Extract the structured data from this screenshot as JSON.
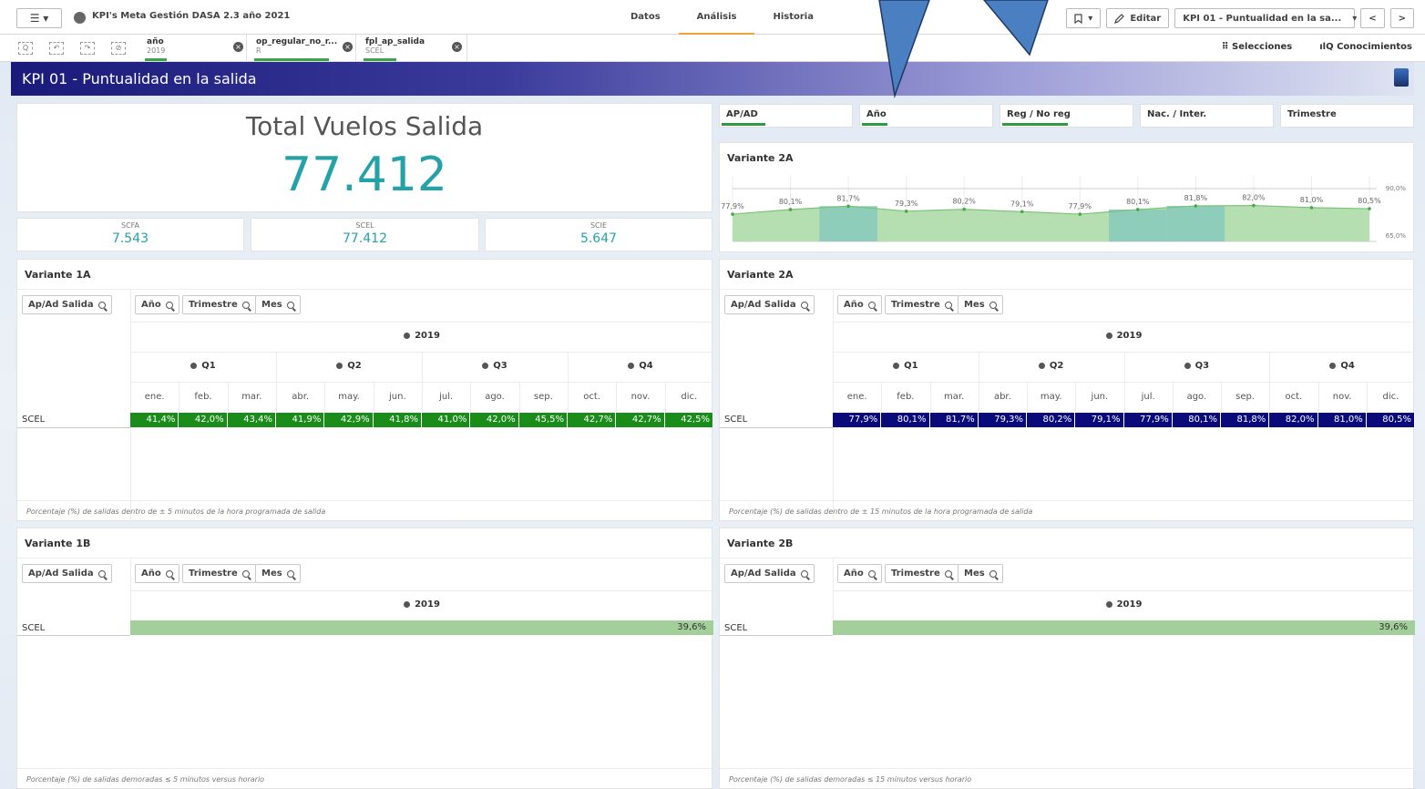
{
  "app": {
    "title": "KPI's Meta Gestión DASA 2.3 año 2021",
    "menu_label": "☰ ▾"
  },
  "nav_tabs": [
    {
      "label": "Datos"
    },
    {
      "label": "Análisis"
    },
    {
      "label": "Historia"
    }
  ],
  "toolbar": {
    "bookmark_label": "▾",
    "edit_label": "Editar",
    "sheet_selector": "KPI 01 - Puntualidad en la sa...",
    "prev": "<",
    "next": ">"
  },
  "selections": {
    "chips": [
      {
        "field": "año",
        "value": "2019"
      },
      {
        "field": "op_regular_no_r...",
        "value": "R"
      },
      {
        "field": "fpl_ap_salida",
        "value": "SCEL"
      }
    ],
    "selecciones_label": "Selecciones",
    "conocimientos_label": "Conocimientos"
  },
  "sheet": {
    "title": "KPI 01 - Puntualidad en la salida"
  },
  "kpi": {
    "title": "Total Vuelos Salida",
    "value": "77.412",
    "subs": [
      {
        "label": "SCFA",
        "value": "7.543"
      },
      {
        "label": "SCEL",
        "value": "77.412"
      },
      {
        "label": "SCIE",
        "value": "5.647"
      }
    ]
  },
  "filters": [
    {
      "label": "AP/AD"
    },
    {
      "label": "Año"
    },
    {
      "label": "Reg / No reg"
    },
    {
      "label": "Nac. / Inter."
    },
    {
      "label": "Trimestre"
    }
  ],
  "trend_chart": {
    "title": "Variante 2A",
    "ref_top": "90,0%",
    "ref_bottom": "65,0%"
  },
  "chart_data": {
    "type": "area",
    "categories": [
      "ene.",
      "feb.",
      "mar.",
      "abr.",
      "may.",
      "jun.",
      "jul.",
      "ago.",
      "sep.",
      "oct.",
      "nov.",
      "dic."
    ],
    "series": [
      {
        "values": [
          77.9,
          80.1,
          81.7,
          79.3,
          80.2,
          79.1,
          77.9,
          80.1,
          81.8,
          82.0,
          81.0,
          80.5
        ]
      }
    ],
    "labels": [
      "77,9%",
      "80,1%",
      "81,7%",
      "79,3%",
      "80,2%",
      "79,1%",
      "77,9%",
      "80,1%",
      "81,8%",
      "82,0%",
      "81,0%",
      "80,5%"
    ],
    "ylim": [
      65,
      90
    ],
    "reference_lines": [
      90,
      65
    ],
    "highlighted_bands": [
      "mar.",
      "ago.",
      "sep."
    ]
  },
  "pivot_buttons": {
    "apad": "Ap/Ad Salida",
    "ano": "Año",
    "trimestre": "Trimestre",
    "mes": "Mes"
  },
  "pivot_common": {
    "year": "2019",
    "quarters": [
      "Q1",
      "Q2",
      "Q3",
      "Q4"
    ],
    "months": [
      "ene.",
      "feb.",
      "mar.",
      "abr.",
      "may.",
      "jun.",
      "jul.",
      "ago.",
      "sep.",
      "oct.",
      "nov.",
      "dic."
    ],
    "row_label": "SCEL"
  },
  "v1a": {
    "title": "Variante 1A",
    "values": [
      "41,4%",
      "42,0%",
      "43,4%",
      "41,9%",
      "42,9%",
      "41,8%",
      "41,0%",
      "42,0%",
      "45,5%",
      "42,7%",
      "42,7%",
      "42,5%"
    ],
    "color": "#1a8c1a",
    "footnote": "Porcentaje (%) de salidas dentro de ± 5 minutos de la hora programada de salida"
  },
  "v2a": {
    "title": "Variante 2A",
    "values": [
      "77,9%",
      "80,1%",
      "81,7%",
      "79,3%",
      "80,2%",
      "79,1%",
      "77,9%",
      "80,1%",
      "81,8%",
      "82,0%",
      "81,0%",
      "80,5%"
    ],
    "color": "#0a0a7a",
    "footnote": "Porcentaje (%) de salidas dentro de ± 15 minutos de la hora programada de salida"
  },
  "v1b": {
    "title": "Variante 1B",
    "value": "39,6%",
    "footnote": "Porcentaje (%) de salidas demoradas ≤ 5 minutos versus horario"
  },
  "v2b": {
    "title": "Variante 2B",
    "value": "39,6%",
    "footnote": "Porcentaje (%) de salidas demoradas ≤ 15 minutos versus horario"
  }
}
